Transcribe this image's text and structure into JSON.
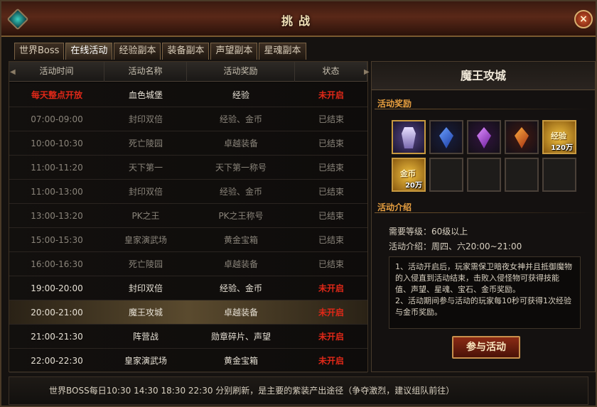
{
  "window": {
    "title": "挑战",
    "close_label": "×"
  },
  "tabs": [
    {
      "label": "世界Boss"
    },
    {
      "label": "在线活动"
    },
    {
      "label": "经验副本"
    },
    {
      "label": "装备副本"
    },
    {
      "label": "声望副本"
    },
    {
      "label": "星魂副本"
    }
  ],
  "active_tab": "在线活动",
  "table": {
    "headers": [
      "活动时间",
      "活动名称",
      "活动奖励",
      "状态"
    ],
    "rows": [
      {
        "time": "每天整点开放",
        "name": "血色城堡",
        "reward": "经验",
        "status": "未开启"
      },
      {
        "time": "07:00-09:00",
        "name": "封印双倍",
        "reward": "经验、金币",
        "status": "已结束"
      },
      {
        "time": "10:00-10:30",
        "name": "死亡陵园",
        "reward": "卓越装备",
        "status": "已结束"
      },
      {
        "time": "11:00-11:20",
        "name": "天下第一",
        "reward": "天下第一称号",
        "status": "已结束"
      },
      {
        "time": "11:00-13:00",
        "name": "封印双倍",
        "reward": "经验、金币",
        "status": "已结束"
      },
      {
        "time": "13:00-13:20",
        "name": "PK之王",
        "reward": "PK之王称号",
        "status": "已结束"
      },
      {
        "time": "15:00-15:30",
        "name": "皇家演武场",
        "reward": "黄金宝箱",
        "status": "已结束"
      },
      {
        "time": "16:00-16:30",
        "name": "死亡陵园",
        "reward": "卓越装备",
        "status": "已结束"
      },
      {
        "time": "19:00-20:00",
        "name": "封印双倍",
        "reward": "经验、金币",
        "status": "未开启"
      },
      {
        "time": "20:00-21:00",
        "name": "魔王攻城",
        "reward": "卓越装备",
        "status": "未开启"
      },
      {
        "time": "21:00-21:30",
        "name": "阵营战",
        "reward": "勋章碎片、声望",
        "status": "未开启"
      },
      {
        "time": "22:00-22:30",
        "name": "皇家演武场",
        "reward": "黄金宝箱",
        "status": "未开启"
      }
    ]
  },
  "detail": {
    "title": "魔王攻城",
    "rewards_label": "活动奖励",
    "rewards": [
      {
        "icon": "armor-set-icon",
        "qty": ""
      },
      {
        "icon": "blue-gem-icon",
        "qty": ""
      },
      {
        "icon": "purple-gem-icon",
        "qty": ""
      },
      {
        "icon": "orange-gem-icon",
        "qty": ""
      },
      {
        "icon": "exp-coin-icon",
        "label": "经验",
        "qty": "120万"
      },
      {
        "icon": "gold-coin-icon",
        "label": "金币",
        "qty": "20万"
      },
      {
        "icon": "empty-slot",
        "qty": ""
      },
      {
        "icon": "empty-slot",
        "qty": ""
      },
      {
        "icon": "empty-slot",
        "qty": ""
      },
      {
        "icon": "empty-slot",
        "qty": ""
      }
    ],
    "intro_label": "活动介绍",
    "level_req": "需要等级：60级以上",
    "schedule": "活动介绍：周四、六20:00~21:00",
    "description": [
      "1、活动开启后，玩家需保卫暗夜女神并且抵御魔物的入侵直到活动结束，击败入侵怪物可获得技能值、声望、星魂、宝石、金币奖励。",
      "2、活动期间参与活动的玩家每10秒可获得1次经验与金币奖励。"
    ],
    "join_label": "参与活动"
  },
  "footer": {
    "text": "世界BOSS每日10:30  14:30  18:30  22:30  分别刷新，是主要的紫装产出途径（争夺激烈，建议组队前往）"
  },
  "colors": {
    "status_closed": "#e02818",
    "section_label": "#e8a040",
    "frame": "#4a3a28"
  }
}
